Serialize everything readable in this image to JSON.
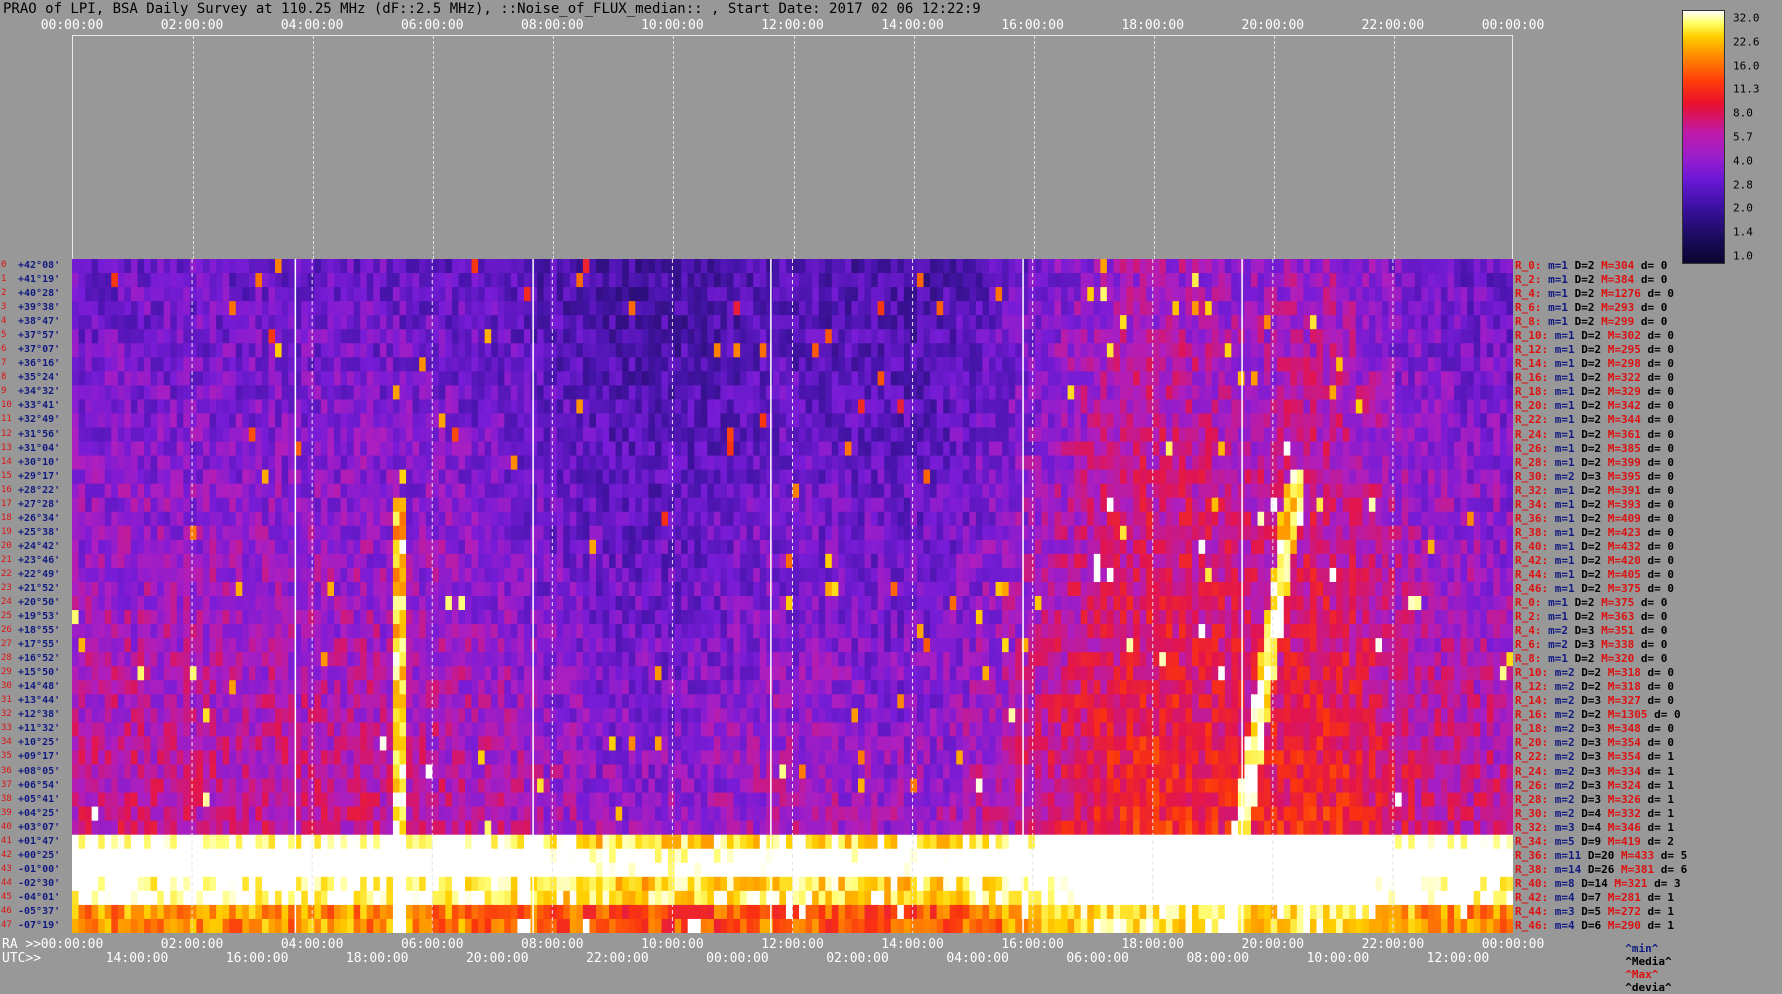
{
  "title": "PRAO of LPI, BSA Daily Survey at 110.25 MHz (dF::2.5 MHz), ::Noise_of_FLUX_median:: , Start Date: 2017 02 06 12:22:9",
  "chart_data": {
    "type": "heatmap",
    "title": "PRAO of LPI, BSA Daily Survey at 110.25 MHz (dF::2.5 MHz), ::Noise_of_FLUX_median:: , Start Date: 2017 02 06 12:22:9",
    "top_axis_ticks": [
      "00:00:00",
      "02:00:00",
      "04:00:00",
      "06:00:00",
      "08:00:00",
      "10:00:00",
      "12:00:00",
      "14:00:00",
      "16:00:00",
      "18:00:00",
      "20:00:00",
      "22:00:00",
      "00:00:00"
    ],
    "ra_axis_prefix": "RA >>",
    "ra_axis_ticks": [
      "00:00:00",
      "02:00:00",
      "04:00:00",
      "06:00:00",
      "08:00:00",
      "10:00:00",
      "12:00:00",
      "14:00:00",
      "16:00:00",
      "18:00:00",
      "20:00:00",
      "22:00:00",
      "00:00:00"
    ],
    "utc_axis_prefix": "UTC>>",
    "utc_axis_ticks": [
      "14:00:00",
      "16:00:00",
      "18:00:00",
      "20:00:00",
      "22:00:00",
      "00:00:00",
      "02:00:00",
      "04:00:00",
      "06:00:00",
      "08:00:00",
      "10:00:00",
      "12:00:00"
    ],
    "declinations": [
      "+42°08'",
      "+41°19'",
      "+40°28'",
      "+39°38'",
      "+38°47'",
      "+37°57'",
      "+37°07'",
      "+36°16'",
      "+35°24'",
      "+34°32'",
      "+33°41'",
      "+32°49'",
      "+31°56'",
      "+31°04'",
      "+30°10'",
      "+29°17'",
      "+28°22'",
      "+27°28'",
      "+26°34'",
      "+25°38'",
      "+24°42'",
      "+23°46'",
      "+22°49'",
      "+21°52'",
      "+20°50'",
      "+19°53'",
      "+18°55'",
      "+17°55'",
      "+16°52'",
      "+15°50'",
      "+14°48'",
      "+13°44'",
      "+12°38'",
      "+11°32'",
      "+10°25'",
      "+09°17'",
      "+08°05'",
      "+06°54'",
      "+05°41'",
      "+04°25'",
      "+03°07'",
      "+01°47'",
      "+00°25'",
      "-01°00'",
      "-02°30'",
      "-04°01'",
      "-05°37'",
      "-07°19'"
    ],
    "row_numbers": [
      "0",
      "1",
      "2",
      "3",
      "4",
      "5",
      "6",
      "7",
      "8",
      "9",
      "10",
      "11",
      "12",
      "13",
      "14",
      "15",
      "16",
      "17",
      "18",
      "19",
      "20",
      "21",
      "22",
      "23",
      "24",
      "25",
      "26",
      "27",
      "28",
      "29",
      "30",
      "31",
      "32",
      "33",
      "34",
      "35",
      "36",
      "37",
      "38",
      "39",
      "40",
      "41",
      "42",
      "43",
      "44",
      "45",
      "46",
      "47"
    ],
    "colorbar": {
      "ticks": [
        "32.0",
        "22.6",
        "16.0",
        "11.3",
        "8.0",
        "5.7",
        "4.0",
        "2.8",
        "2.0",
        "1.4",
        "1.0"
      ],
      "range": [
        1.0,
        32.0
      ],
      "scale": "log"
    },
    "ray_stats": [
      {
        "ray": "R_0:",
        "m": "m=1",
        "d": "D=2",
        "M": "M=304",
        "dev": "d= 0"
      },
      {
        "ray": "R_2:",
        "m": "m=1",
        "d": "D=2",
        "M": "M=384",
        "dev": "d= 0"
      },
      {
        "ray": "R_4:",
        "m": "m=1",
        "d": "D=2",
        "M": "M=1276",
        "dev": "d= 0"
      },
      {
        "ray": "R_6:",
        "m": "m=1",
        "d": "D=2",
        "M": "M=293",
        "dev": "d= 0"
      },
      {
        "ray": "R_8:",
        "m": "m=1",
        "d": "D=2",
        "M": "M=299",
        "dev": "d= 0"
      },
      {
        "ray": "R_10:",
        "m": "m=1",
        "d": "D=2",
        "M": "M=302",
        "dev": "d= 0"
      },
      {
        "ray": "R_12:",
        "m": "m=1",
        "d": "D=2",
        "M": "M=295",
        "dev": "d= 0"
      },
      {
        "ray": "R_14:",
        "m": "m=1",
        "d": "D=2",
        "M": "M=298",
        "dev": "d= 0"
      },
      {
        "ray": "R_16:",
        "m": "m=1",
        "d": "D=2",
        "M": "M=322",
        "dev": "d= 0"
      },
      {
        "ray": "R_18:",
        "m": "m=1",
        "d": "D=2",
        "M": "M=329",
        "dev": "d= 0"
      },
      {
        "ray": "R_20:",
        "m": "m=1",
        "d": "D=2",
        "M": "M=342",
        "dev": "d= 0"
      },
      {
        "ray": "R_22:",
        "m": "m=1",
        "d": "D=2",
        "M": "M=344",
        "dev": "d= 0"
      },
      {
        "ray": "R_24:",
        "m": "m=1",
        "d": "D=2",
        "M": "M=361",
        "dev": "d= 0"
      },
      {
        "ray": "R_26:",
        "m": "m=1",
        "d": "D=2",
        "M": "M=385",
        "dev": "d= 0"
      },
      {
        "ray": "R_28:",
        "m": "m=1",
        "d": "D=2",
        "M": "M=399",
        "dev": "d= 0"
      },
      {
        "ray": "R_30:",
        "m": "m=2",
        "d": "D=3",
        "M": "M=395",
        "dev": "d= 0"
      },
      {
        "ray": "R_32:",
        "m": "m=1",
        "d": "D=2",
        "M": "M=391",
        "dev": "d= 0"
      },
      {
        "ray": "R_34:",
        "m": "m=1",
        "d": "D=2",
        "M": "M=393",
        "dev": "d= 0"
      },
      {
        "ray": "R_36:",
        "m": "m=1",
        "d": "D=2",
        "M": "M=409",
        "dev": "d= 0"
      },
      {
        "ray": "R_38:",
        "m": "m=1",
        "d": "D=2",
        "M": "M=423",
        "dev": "d= 0"
      },
      {
        "ray": "R_40:",
        "m": "m=1",
        "d": "D=2",
        "M": "M=432",
        "dev": "d= 0"
      },
      {
        "ray": "R_42:",
        "m": "m=1",
        "d": "D=2",
        "M": "M=420",
        "dev": "d= 0"
      },
      {
        "ray": "R_44:",
        "m": "m=1",
        "d": "D=2",
        "M": "M=405",
        "dev": "d= 0"
      },
      {
        "ray": "R_46:",
        "m": "m=1",
        "d": "D=2",
        "M": "M=375",
        "dev": "d= 0"
      },
      {
        "ray": "R_0:",
        "m": "m=1",
        "d": "D=2",
        "M": "M=375",
        "dev": "d= 0"
      },
      {
        "ray": "R_2:",
        "m": "m=1",
        "d": "D=2",
        "M": "M=363",
        "dev": "d= 0"
      },
      {
        "ray": "R_4:",
        "m": "m=2",
        "d": "D=3",
        "M": "M=351",
        "dev": "d= 0"
      },
      {
        "ray": "R_6:",
        "m": "m=2",
        "d": "D=3",
        "M": "M=338",
        "dev": "d= 0"
      },
      {
        "ray": "R_8:",
        "m": "m=1",
        "d": "D=2",
        "M": "M=320",
        "dev": "d= 0"
      },
      {
        "ray": "R_10:",
        "m": "m=2",
        "d": "D=2",
        "M": "M=318",
        "dev": "d= 0"
      },
      {
        "ray": "R_12:",
        "m": "m=2",
        "d": "D=2",
        "M": "M=318",
        "dev": "d= 0"
      },
      {
        "ray": "R_14:",
        "m": "m=2",
        "d": "D=3",
        "M": "M=327",
        "dev": "d= 0"
      },
      {
        "ray": "R_16:",
        "m": "m=2",
        "d": "D=2",
        "M": "M=1305",
        "dev": "d= 0"
      },
      {
        "ray": "R_18:",
        "m": "m=2",
        "d": "D=3",
        "M": "M=348",
        "dev": "d= 0"
      },
      {
        "ray": "R_20:",
        "m": "m=2",
        "d": "D=3",
        "M": "M=354",
        "dev": "d= 0"
      },
      {
        "ray": "R_22:",
        "m": "m=2",
        "d": "D=3",
        "M": "M=354",
        "dev": "d= 1"
      },
      {
        "ray": "R_24:",
        "m": "m=2",
        "d": "D=3",
        "M": "M=334",
        "dev": "d= 1"
      },
      {
        "ray": "R_26:",
        "m": "m=2",
        "d": "D=3",
        "M": "M=324",
        "dev": "d= 1"
      },
      {
        "ray": "R_28:",
        "m": "m=2",
        "d": "D=3",
        "M": "M=326",
        "dev": "d= 1"
      },
      {
        "ray": "R_30:",
        "m": "m=2",
        "d": "D=4",
        "M": "M=332",
        "dev": "d= 1"
      },
      {
        "ray": "R_32:",
        "m": "m=3",
        "d": "D=4",
        "M": "M=346",
        "dev": "d= 1"
      },
      {
        "ray": "R_34:",
        "m": "m=5",
        "d": "D=9",
        "M": "M=419",
        "dev": "d= 2"
      },
      {
        "ray": "R_36:",
        "m": "m=11",
        "d": "D=20",
        "M": "M=433",
        "dev": "d= 5"
      },
      {
        "ray": "R_38:",
        "m": "m=14",
        "d": "D=26",
        "M": "M=381",
        "dev": "d= 6"
      },
      {
        "ray": "R_40:",
        "m": "m=8",
        "d": "D=14",
        "M": "M=321",
        "dev": "d= 3"
      },
      {
        "ray": "R_42:",
        "m": "m=4",
        "d": "D=7",
        "M": "M=281",
        "dev": "d= 1"
      },
      {
        "ray": "R_44:",
        "m": "m=3",
        "d": "D=5",
        "M": "M=272",
        "dev": "d= 1"
      },
      {
        "ray": "R_46:",
        "m": "m=4",
        "d": "D=6",
        "M": "M=290",
        "dev": "d= 1"
      }
    ],
    "stats_legend": {
      "min": "^min^",
      "media": "^Media^",
      "max": "^Max^",
      "devia": "^devia^"
    }
  },
  "colors": {
    "background": "#989898",
    "grid": "#e0e0e0",
    "ray_label": "#dd1111",
    "dec_label": "#111a80"
  }
}
